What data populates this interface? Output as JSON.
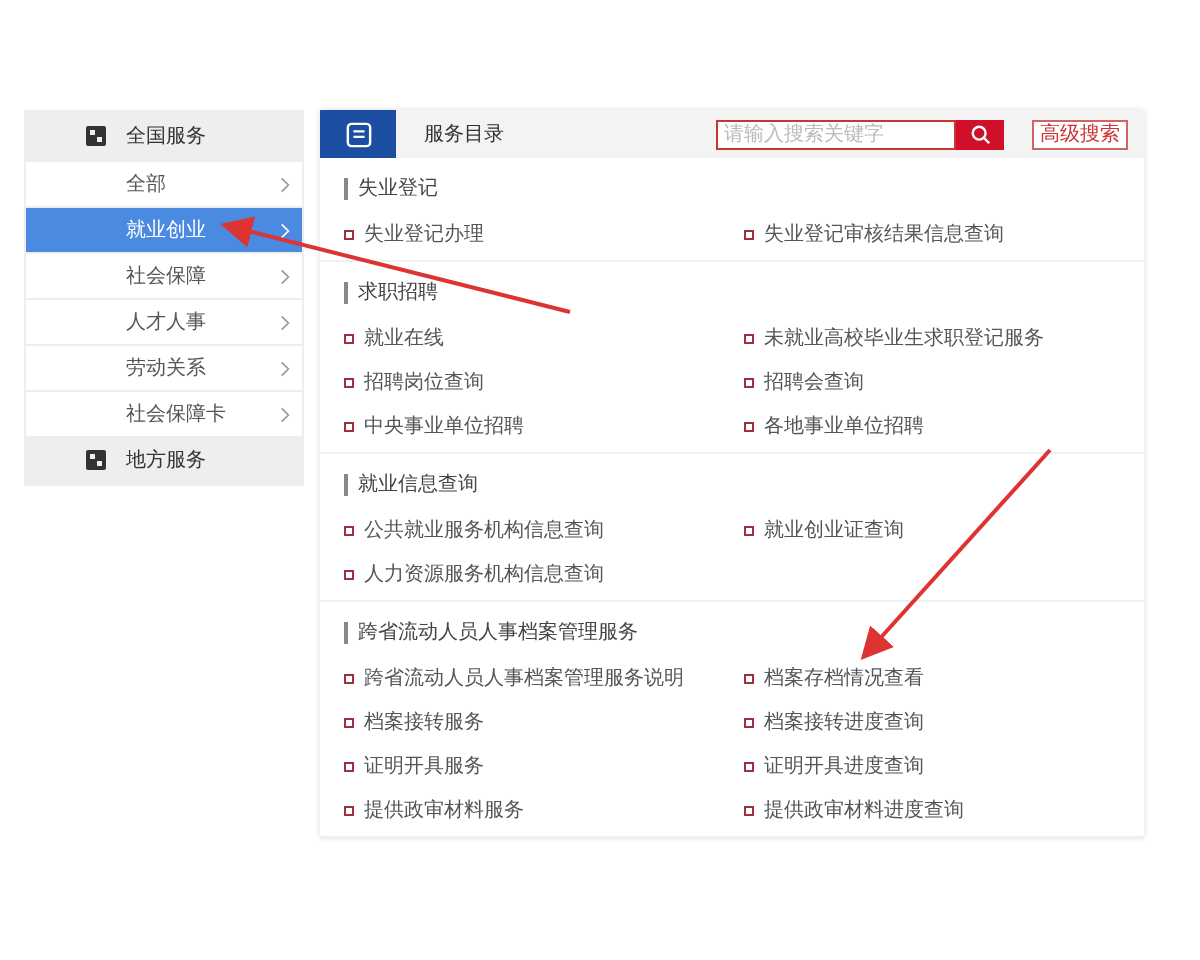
{
  "sidebar": {
    "groups": [
      {
        "label": "全国服务",
        "items": [
          {
            "label": "全部",
            "selected": false
          },
          {
            "label": "就业创业",
            "selected": true
          },
          {
            "label": "社会保障",
            "selected": false
          },
          {
            "label": "人才人事",
            "selected": false
          },
          {
            "label": "劳动关系",
            "selected": false
          },
          {
            "label": "社会保障卡",
            "selected": false
          }
        ]
      },
      {
        "label": "地方服务"
      }
    ]
  },
  "main": {
    "title": "服务目录",
    "search": {
      "placeholder": "请输入搜索关键字"
    },
    "advanced_search": "高级搜索",
    "sections": [
      {
        "title": "失业登记",
        "items": [
          "失业登记办理",
          "失业登记审核结果信息查询"
        ]
      },
      {
        "title": "求职招聘",
        "items": [
          "就业在线",
          "未就业高校毕业生求职登记服务",
          "招聘岗位查询",
          "招聘会查询",
          "中央事业单位招聘",
          "各地事业单位招聘"
        ]
      },
      {
        "title": "就业信息查询",
        "items": [
          "公共就业服务机构信息查询",
          "就业创业证查询",
          "人力资源服务机构信息查询"
        ]
      },
      {
        "title": "跨省流动人员人事档案管理服务",
        "items": [
          "跨省流动人员人事档案管理服务说明",
          "档案存档情况查看",
          "档案接转服务",
          "档案接转进度查询",
          "证明开具服务",
          "证明开具进度查询",
          "提供政审材料服务",
          "提供政审材料进度查询"
        ]
      }
    ]
  }
}
